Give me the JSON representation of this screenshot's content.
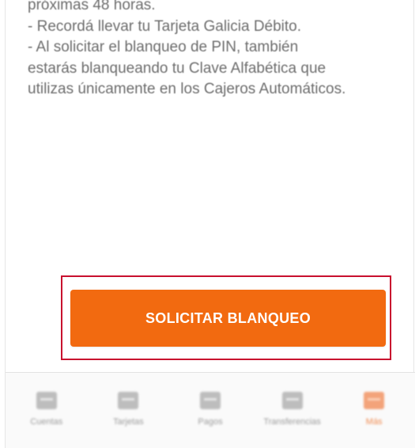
{
  "info": {
    "lines": [
      "próximas 48 horas.",
      "- Recordá llevar tu Tarjeta Galicia Débito.",
      "- Al solicitar el blanqueo de PIN, también",
      "estarás blanqueando tu Clave Alfabética que",
      "utilizas únicamente en los Cajeros Automáticos."
    ]
  },
  "cta": {
    "label": "SOLICITAR BLANQUEO",
    "color": "#f26a10",
    "highlight_color": "#c8102e"
  },
  "bottom_nav": {
    "items": [
      {
        "label": "Cuentas",
        "icon": "wallet-icon"
      },
      {
        "label": "Tarjetas",
        "icon": "card-icon"
      },
      {
        "label": "Pagos",
        "icon": "receipt-icon"
      },
      {
        "label": "Transferencias",
        "icon": "transfer-icon"
      },
      {
        "label": "Más",
        "icon": "menu-icon",
        "active": true
      }
    ]
  }
}
